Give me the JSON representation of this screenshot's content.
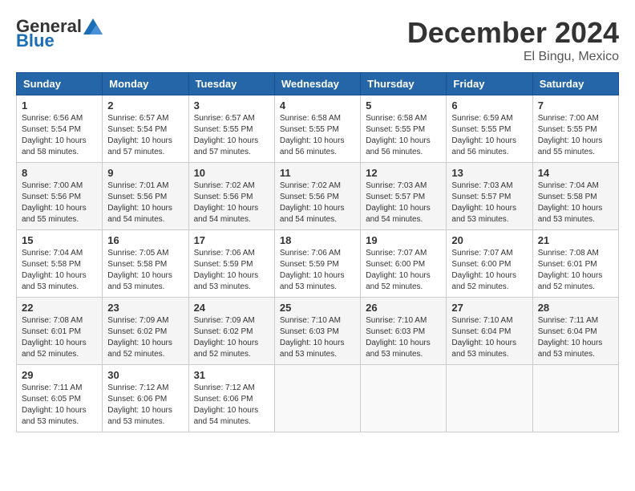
{
  "header": {
    "logo_general": "General",
    "logo_blue": "Blue",
    "month_title": "December 2024",
    "location": "El Bingu, Mexico"
  },
  "weekdays": [
    "Sunday",
    "Monday",
    "Tuesday",
    "Wednesday",
    "Thursday",
    "Friday",
    "Saturday"
  ],
  "weeks": [
    [
      {
        "day": "1",
        "info": "Sunrise: 6:56 AM\nSunset: 5:54 PM\nDaylight: 10 hours\nand 58 minutes."
      },
      {
        "day": "2",
        "info": "Sunrise: 6:57 AM\nSunset: 5:54 PM\nDaylight: 10 hours\nand 57 minutes."
      },
      {
        "day": "3",
        "info": "Sunrise: 6:57 AM\nSunset: 5:55 PM\nDaylight: 10 hours\nand 57 minutes."
      },
      {
        "day": "4",
        "info": "Sunrise: 6:58 AM\nSunset: 5:55 PM\nDaylight: 10 hours\nand 56 minutes."
      },
      {
        "day": "5",
        "info": "Sunrise: 6:58 AM\nSunset: 5:55 PM\nDaylight: 10 hours\nand 56 minutes."
      },
      {
        "day": "6",
        "info": "Sunrise: 6:59 AM\nSunset: 5:55 PM\nDaylight: 10 hours\nand 56 minutes."
      },
      {
        "day": "7",
        "info": "Sunrise: 7:00 AM\nSunset: 5:55 PM\nDaylight: 10 hours\nand 55 minutes."
      }
    ],
    [
      {
        "day": "8",
        "info": "Sunrise: 7:00 AM\nSunset: 5:56 PM\nDaylight: 10 hours\nand 55 minutes."
      },
      {
        "day": "9",
        "info": "Sunrise: 7:01 AM\nSunset: 5:56 PM\nDaylight: 10 hours\nand 54 minutes."
      },
      {
        "day": "10",
        "info": "Sunrise: 7:02 AM\nSunset: 5:56 PM\nDaylight: 10 hours\nand 54 minutes."
      },
      {
        "day": "11",
        "info": "Sunrise: 7:02 AM\nSunset: 5:56 PM\nDaylight: 10 hours\nand 54 minutes."
      },
      {
        "day": "12",
        "info": "Sunrise: 7:03 AM\nSunset: 5:57 PM\nDaylight: 10 hours\nand 54 minutes."
      },
      {
        "day": "13",
        "info": "Sunrise: 7:03 AM\nSunset: 5:57 PM\nDaylight: 10 hours\nand 53 minutes."
      },
      {
        "day": "14",
        "info": "Sunrise: 7:04 AM\nSunset: 5:58 PM\nDaylight: 10 hours\nand 53 minutes."
      }
    ],
    [
      {
        "day": "15",
        "info": "Sunrise: 7:04 AM\nSunset: 5:58 PM\nDaylight: 10 hours\nand 53 minutes."
      },
      {
        "day": "16",
        "info": "Sunrise: 7:05 AM\nSunset: 5:58 PM\nDaylight: 10 hours\nand 53 minutes."
      },
      {
        "day": "17",
        "info": "Sunrise: 7:06 AM\nSunset: 5:59 PM\nDaylight: 10 hours\nand 53 minutes."
      },
      {
        "day": "18",
        "info": "Sunrise: 7:06 AM\nSunset: 5:59 PM\nDaylight: 10 hours\nand 53 minutes."
      },
      {
        "day": "19",
        "info": "Sunrise: 7:07 AM\nSunset: 6:00 PM\nDaylight: 10 hours\nand 52 minutes."
      },
      {
        "day": "20",
        "info": "Sunrise: 7:07 AM\nSunset: 6:00 PM\nDaylight: 10 hours\nand 52 minutes."
      },
      {
        "day": "21",
        "info": "Sunrise: 7:08 AM\nSunset: 6:01 PM\nDaylight: 10 hours\nand 52 minutes."
      }
    ],
    [
      {
        "day": "22",
        "info": "Sunrise: 7:08 AM\nSunset: 6:01 PM\nDaylight: 10 hours\nand 52 minutes."
      },
      {
        "day": "23",
        "info": "Sunrise: 7:09 AM\nSunset: 6:02 PM\nDaylight: 10 hours\nand 52 minutes."
      },
      {
        "day": "24",
        "info": "Sunrise: 7:09 AM\nSunset: 6:02 PM\nDaylight: 10 hours\nand 52 minutes."
      },
      {
        "day": "25",
        "info": "Sunrise: 7:10 AM\nSunset: 6:03 PM\nDaylight: 10 hours\nand 53 minutes."
      },
      {
        "day": "26",
        "info": "Sunrise: 7:10 AM\nSunset: 6:03 PM\nDaylight: 10 hours\nand 53 minutes."
      },
      {
        "day": "27",
        "info": "Sunrise: 7:10 AM\nSunset: 6:04 PM\nDaylight: 10 hours\nand 53 minutes."
      },
      {
        "day": "28",
        "info": "Sunrise: 7:11 AM\nSunset: 6:04 PM\nDaylight: 10 hours\nand 53 minutes."
      }
    ],
    [
      {
        "day": "29",
        "info": "Sunrise: 7:11 AM\nSunset: 6:05 PM\nDaylight: 10 hours\nand 53 minutes."
      },
      {
        "day": "30",
        "info": "Sunrise: 7:12 AM\nSunset: 6:06 PM\nDaylight: 10 hours\nand 53 minutes."
      },
      {
        "day": "31",
        "info": "Sunrise: 7:12 AM\nSunset: 6:06 PM\nDaylight: 10 hours\nand 54 minutes."
      },
      {
        "day": "",
        "info": ""
      },
      {
        "day": "",
        "info": ""
      },
      {
        "day": "",
        "info": ""
      },
      {
        "day": "",
        "info": ""
      }
    ]
  ]
}
